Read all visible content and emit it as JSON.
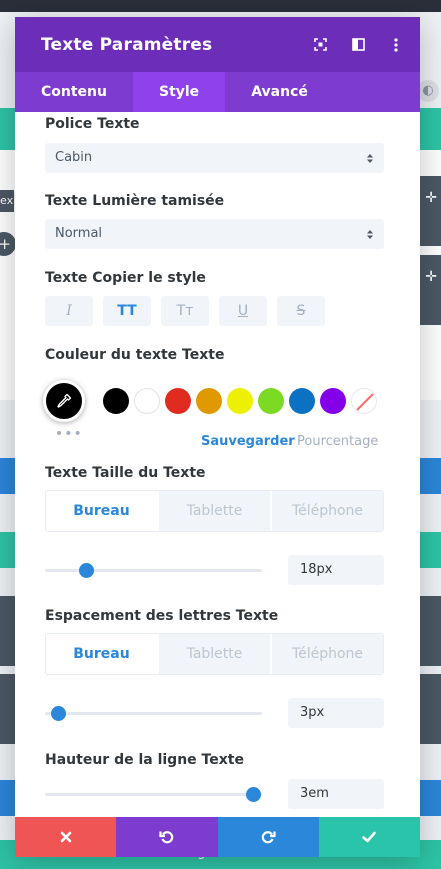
{
  "background": {
    "left_tab_text": "ex",
    "bottom_text": "ligne"
  },
  "modal": {
    "title": "Texte Paramètres",
    "header_icons": [
      "expand-icon",
      "split-view-icon",
      "more-options-icon"
    ],
    "tabs": [
      {
        "label": "Contenu",
        "active": false
      },
      {
        "label": "Style",
        "active": true
      },
      {
        "label": "Avancé",
        "active": false
      }
    ]
  },
  "font": {
    "label": "Police Texte",
    "value": "Cabin"
  },
  "weight": {
    "label": "Texte Lumière tamisée",
    "value": "Normal"
  },
  "style": {
    "label": "Texte Copier le style",
    "buttons": [
      {
        "label": "I",
        "name": "italic",
        "active": false
      },
      {
        "label": "TT",
        "name": "uppercase",
        "active": true
      },
      {
        "label": "Tт",
        "name": "capitalize",
        "active": false
      },
      {
        "label": "U",
        "name": "underline",
        "active": false
      },
      {
        "label": "S",
        "name": "strikethrough",
        "active": false
      }
    ]
  },
  "color": {
    "label": "Couleur du texte Texte",
    "selected": "#000000",
    "swatches": [
      "#000000",
      "#ffffff",
      "#e02b20",
      "#e09900",
      "#edf000",
      "#7cda24",
      "#0c71c3",
      "#8300e9"
    ],
    "more": "•••",
    "save_label": "Sauvegarder",
    "percent_label": "Pourcentage"
  },
  "text_size": {
    "label": "Texte Taille du Texte",
    "devices": [
      "Bureau",
      "Tablette",
      "Téléphone"
    ],
    "active_device": "Bureau",
    "value": "18px",
    "slider_fraction": 0.19
  },
  "letter_spacing": {
    "label": "Espacement des lettres Texte",
    "devices": [
      "Bureau",
      "Tablette",
      "Téléphone"
    ],
    "active_device": "Bureau",
    "value": "3px",
    "slider_fraction": 0.06
  },
  "line_height": {
    "label": "Hauteur de la ligne Texte",
    "value": "3em",
    "slider_fraction": 0.96
  },
  "footer": {
    "buttons": [
      "cancel",
      "undo",
      "redo",
      "save"
    ]
  },
  "colors": {
    "header": "#6c2eb9",
    "tabs": "#7e3bd0",
    "accent": "#2b87da",
    "cancel": "#ef5555",
    "save": "#29c4a9"
  }
}
